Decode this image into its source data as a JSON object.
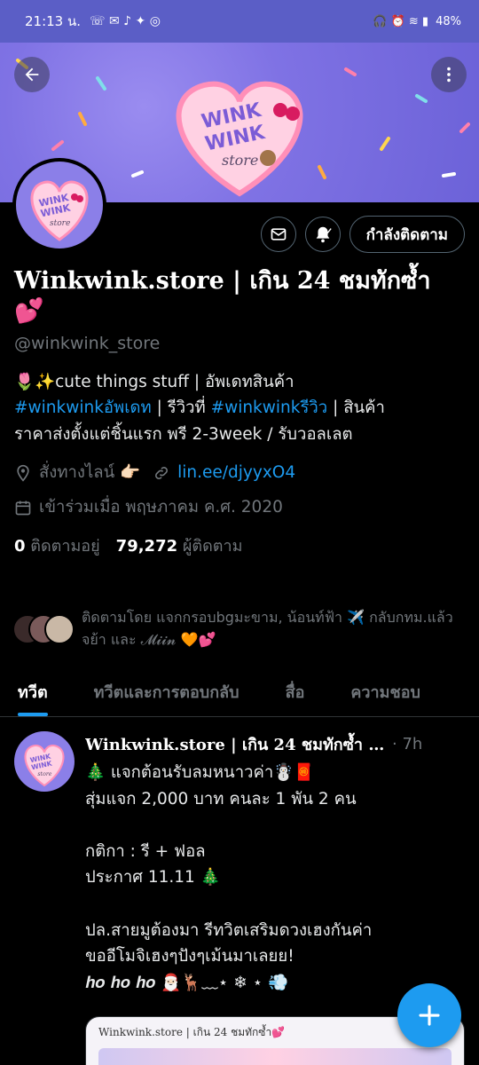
{
  "status_bar": {
    "time": "21:13 น.",
    "battery": "48%"
  },
  "profile": {
    "name": "Winkwink.store | เกิน 24 ชมทักซ้ำ 💕",
    "handle": "@winkwink_store",
    "follow_button": "กำลังติดตาม",
    "bio_line1": "🌷✨cute things stuff | อัพเดทสินค้า",
    "bio_tag1": "#winkwinkอัพเดท",
    "bio_mid": " | รีวิวที่ ",
    "bio_tag2": "#winkwinkรีวิว",
    "bio_end": " | สินค้า",
    "bio_line3": "ราคาส่งตั้งแต่ชิ้นแรก พรี 2-3week / รับวอลเลต",
    "location": "สั่งทางไลน์ 👉🏻",
    "link": "lin.ee/djyyxO4",
    "joined": "เข้าร่วมเมื่อ พฤษภาคม ค.ศ. 2020",
    "following_count": "0",
    "following_label": "ติดตามอยู่",
    "followers_count": "79,272",
    "followers_label": "ผู้ติดตาม",
    "followed_by": "ติดตามโดย แจกกรอบbgมะขาม, น้อนท์ฟ้า ✈️ กลับกทม.แล้วจย้า และ 𝓜𝓲𝓲𝓷 🧡💕"
  },
  "tabs": [
    {
      "label": "ทวีต"
    },
    {
      "label": "ทวีตและการตอบกลับ"
    },
    {
      "label": "สื่อ"
    },
    {
      "label": "ความชอบ"
    }
  ],
  "tweet": {
    "name": "Winkwink.store | เกิน 24 ชมทักซ้ำ 💕",
    "time": "· 7h",
    "text": "🎄 แจกต้อนรับลมหนาวค่า☃️🧧\nสุ่มแจก 2,000 บาท คนละ 1 พัน 2 คน\n\nกติกา : รี + ฟอล\nประกาศ 11.11 🎄\n\nปล.สายมูต้องมา รีทวิตเสริมดวงเฮงกันค่า\nขออีโมจิเฮงๆปังๆเม้นมาเลยย!",
    "signoff": "𝒉𝒐 𝒉𝒐 𝒉𝒐 🎅🏻🦌﹏⋆ ❄︎ ⋆ 💨",
    "image_caption": "Winkwink.store | เกิน 24 ชมทักซ้ำ💕"
  },
  "colors": {
    "accent": "#1d9bf0",
    "banner": "#7f72e4",
    "status_bar": "#5b5ec6"
  },
  "icons": [
    "back-arrow-icon",
    "more-icon",
    "mail-icon",
    "bell-icon",
    "location-icon",
    "link-icon",
    "calendar-icon",
    "compose-plus-icon"
  ]
}
